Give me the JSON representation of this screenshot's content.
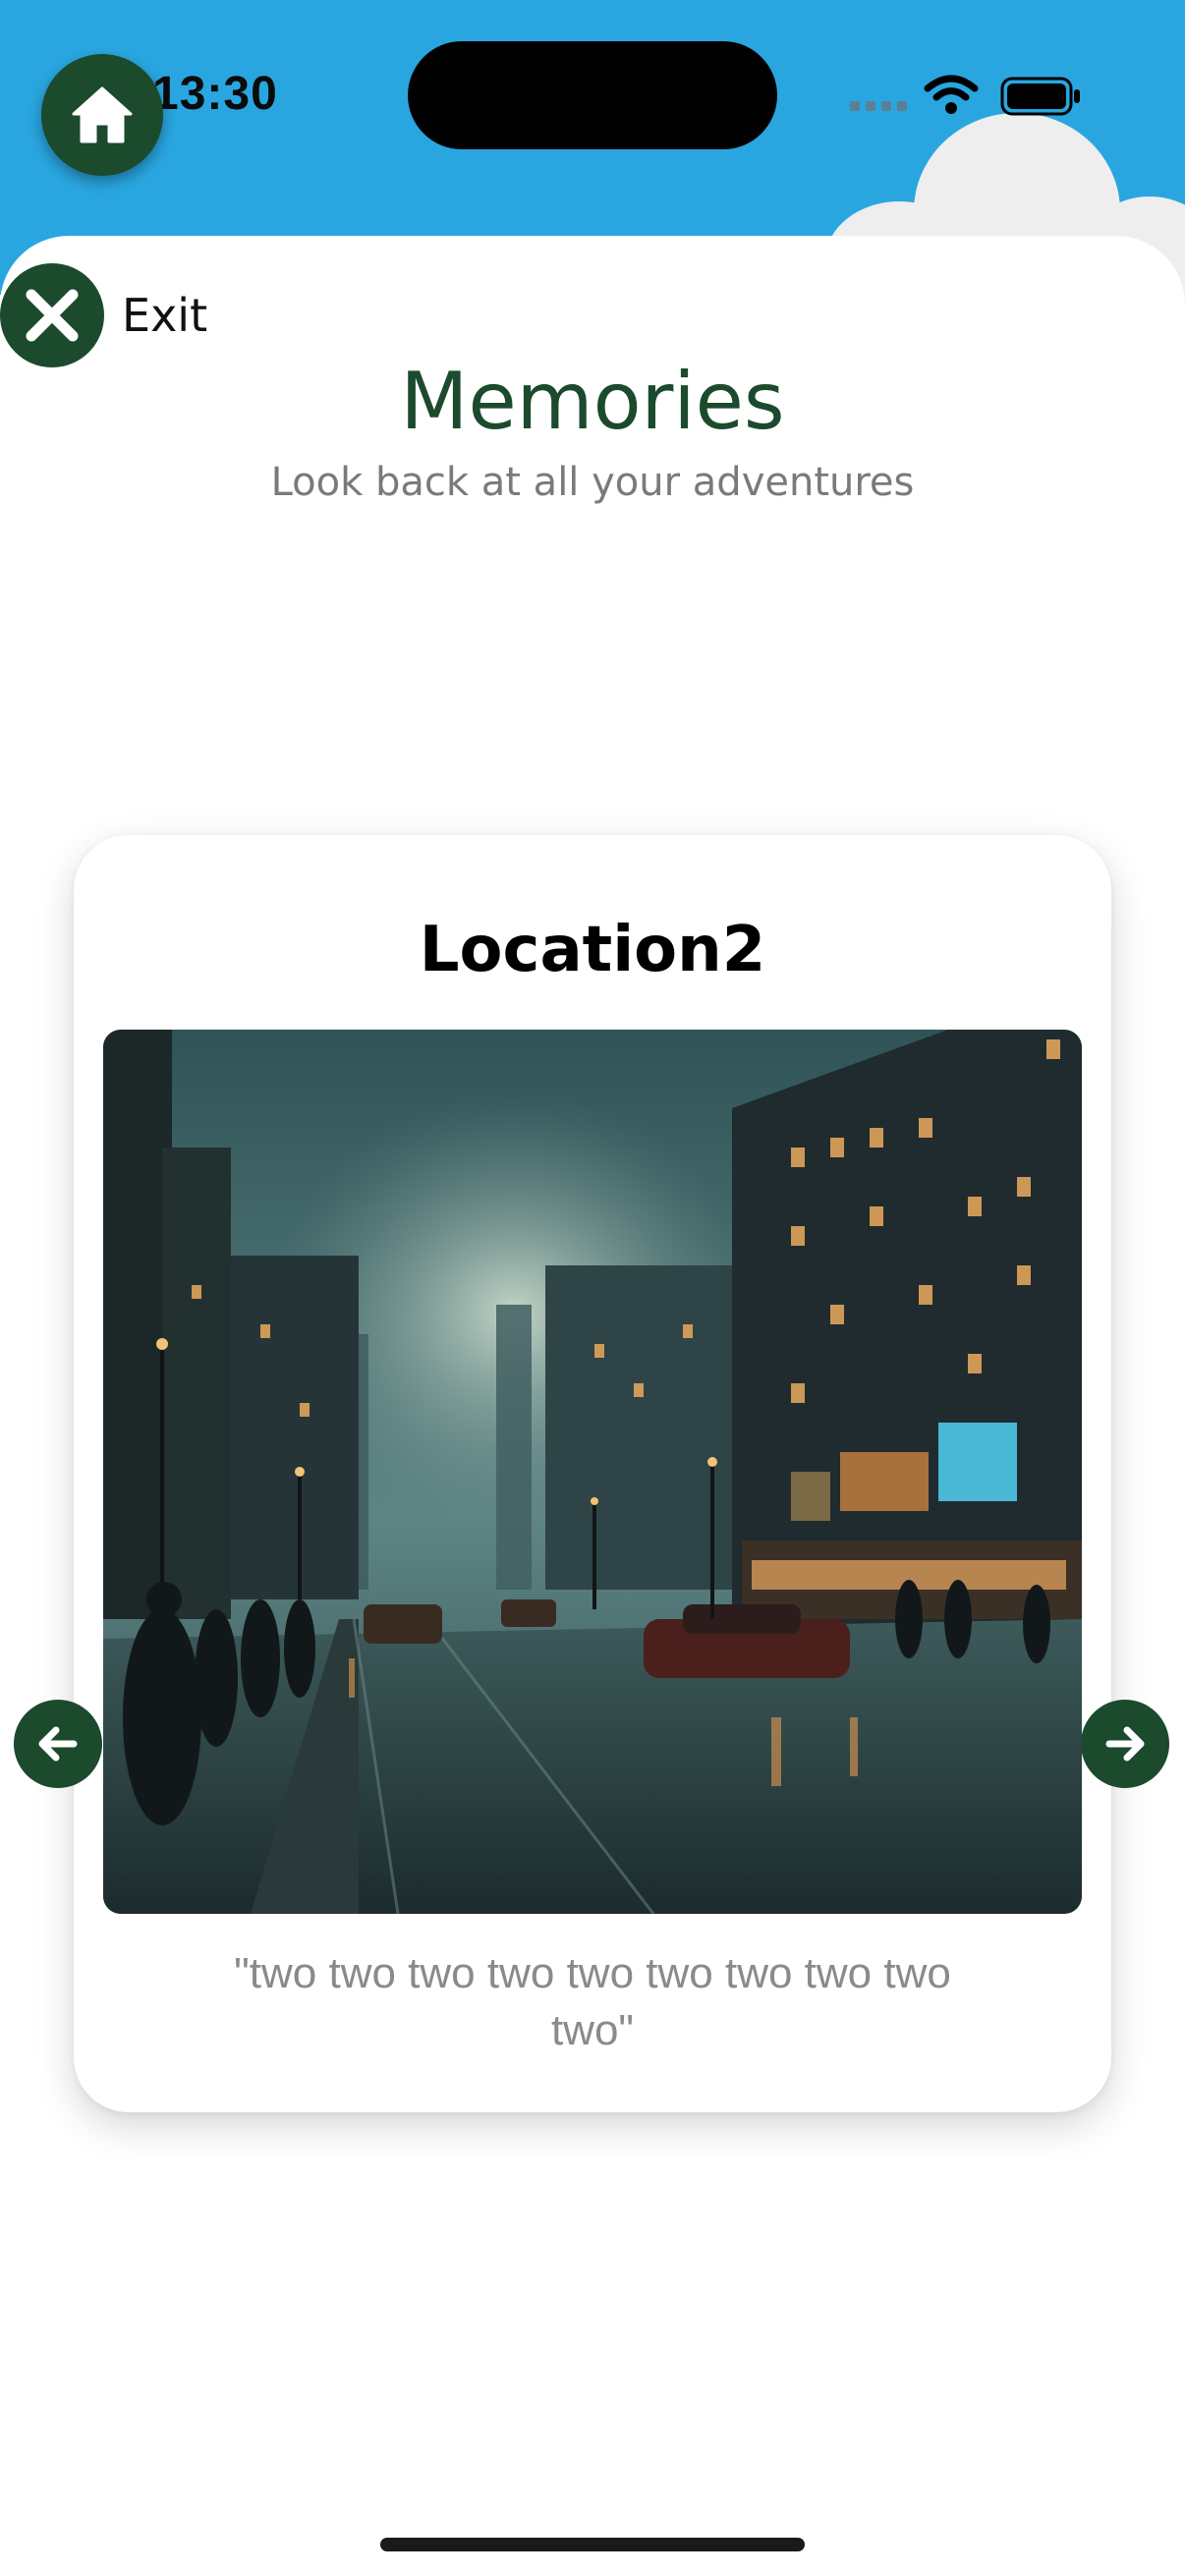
{
  "status_bar": {
    "time": "13:30"
  },
  "header": {
    "home_icon": "home-icon",
    "exit_icon": "close-icon",
    "exit_label": "Exit"
  },
  "page": {
    "title": "Memories",
    "subtitle": "Look back at all your adventures"
  },
  "card": {
    "location": "Location2",
    "caption": "\"two two two two two two two two two two\""
  },
  "nav": {
    "prev_icon": "arrow-left-icon",
    "next_icon": "arrow-right-icon"
  },
  "colors": {
    "header_blue": "#29a6e0",
    "accent_green": "#1b4a2d",
    "caption_gray": "#8a8a8a"
  }
}
